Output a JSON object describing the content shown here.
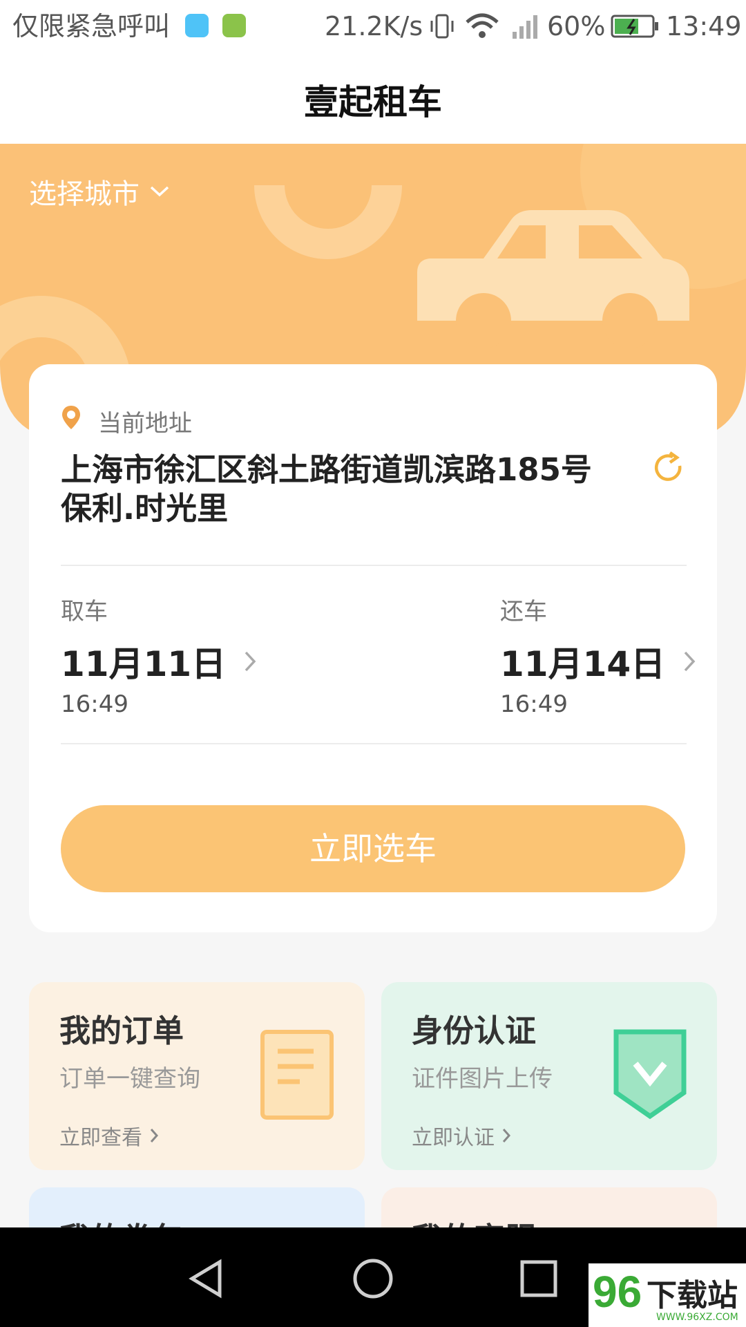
{
  "status_bar": {
    "carrier": "仅限紧急呼叫",
    "speed": "21.2K/s",
    "battery": "60%",
    "time": "13:49"
  },
  "header": {
    "title": "壹起租车"
  },
  "hero": {
    "city_selector": "选择城市"
  },
  "booking": {
    "address_label": "当前地址",
    "address": "上海市徐汇区斜土路街道凯滨路185号保利.时光里",
    "pickup": {
      "label": "取车",
      "date": "11月11日",
      "time": "16:49"
    },
    "return": {
      "label": "还车",
      "date": "11月14日",
      "time": "16:49"
    },
    "cta": "立即选车"
  },
  "tiles": [
    {
      "title": "我的订单",
      "subtitle": "订单一键查询",
      "link": "立即查看"
    },
    {
      "title": "身份认证",
      "subtitle": "证件图片上传",
      "link": "立即认证"
    },
    {
      "title": "我的卷包"
    },
    {
      "title": "我的客服"
    }
  ],
  "watermark": {
    "text": "下载站",
    "number": "96",
    "url": "WWW.96XZ.COM"
  },
  "colors": {
    "accent": "#fbc474",
    "hero": "#fbc177",
    "green": "#3fcf96",
    "location_pin": "#f0a24a"
  },
  "icons": [
    "location-pin-icon",
    "refresh-icon",
    "chevron-down-icon",
    "chevron-right-icon",
    "document-icon",
    "shield-check-icon",
    "back-icon",
    "home-icon",
    "recents-icon"
  ]
}
